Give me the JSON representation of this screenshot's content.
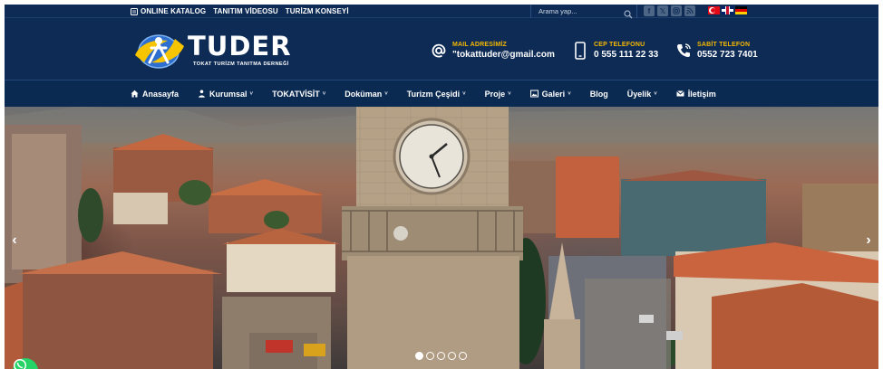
{
  "topbar": {
    "links": [
      {
        "label": "ONLINE KATALOG",
        "icon": "book-icon"
      },
      {
        "label": "TANITIM VİDEOSU",
        "icon": ""
      },
      {
        "label": "TURİZM KONSEYİ",
        "icon": ""
      }
    ],
    "search": {
      "placeholder": "Arama yap...",
      "value": ""
    },
    "socials": [
      "facebook-icon",
      "x-twitter-icon",
      "instagram-icon",
      "rss-icon"
    ],
    "languages": [
      "tr-flag-icon",
      "en-flag-icon",
      "de-flag-icon"
    ]
  },
  "header": {
    "logo": {
      "name": "TUDER",
      "subtitle": "TOKAT TURİZM TANITMA DERNEĞİ"
    },
    "contacts": [
      {
        "label": "MAIL ADRESİMİZ",
        "value": "\"tokattuder@gmail.com",
        "icon": "at-icon"
      },
      {
        "label": "CEP TELEFONU",
        "value": "0 555 111 22 33",
        "icon": "mobile-phone-icon"
      },
      {
        "label": "SABİT TELEFON",
        "value": "0552 723 7401",
        "icon": "phone-icon"
      }
    ]
  },
  "nav": {
    "items": [
      {
        "label": "Anasayfa",
        "icon": "home-icon",
        "dropdown": false
      },
      {
        "label": "Kurumsal",
        "icon": "users-icon",
        "dropdown": true
      },
      {
        "label": "TOKATVİSİT",
        "icon": "",
        "dropdown": true
      },
      {
        "label": "Doküman",
        "icon": "",
        "dropdown": true
      },
      {
        "label": "Turizm Çeşidi",
        "icon": "",
        "dropdown": true
      },
      {
        "label": "Proje",
        "icon": "",
        "dropdown": true
      },
      {
        "label": "Galeri",
        "icon": "image-icon",
        "dropdown": true
      },
      {
        "label": "Blog",
        "icon": "",
        "dropdown": false
      },
      {
        "label": "Üyelik",
        "icon": "",
        "dropdown": true
      },
      {
        "label": "İletişim",
        "icon": "envelope-icon",
        "dropdown": false
      }
    ],
    "caret": "˅"
  },
  "slider": {
    "prev": "‹",
    "next": "›",
    "slide_count": 5,
    "active_index": 0
  },
  "colors": {
    "header_bg": "#0d2b55",
    "accent_yellow": "#f6b800",
    "whatsapp_green": "#25d366"
  }
}
